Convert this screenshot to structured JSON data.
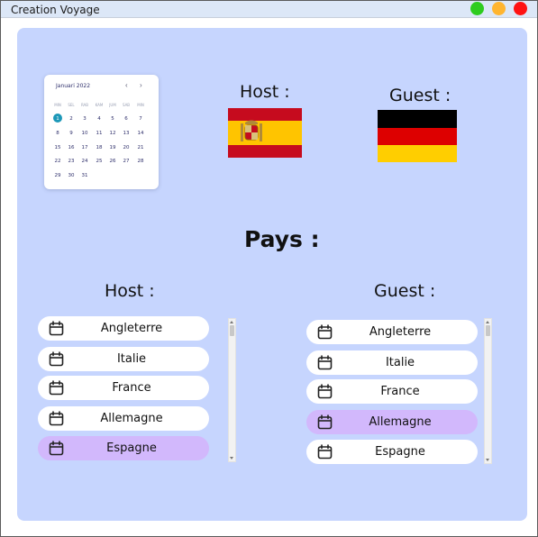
{
  "window": {
    "title": "Creation Voyage",
    "controls": {
      "green": "#2ecc1f",
      "yellow": "#ffb530",
      "red": "#ff1212"
    }
  },
  "calendar": {
    "month_label": "Januari 2022",
    "prev_icon": "chevron-left-icon",
    "next_icon": "chevron-right-icon",
    "weekdays": [
      "MIN",
      "SEL",
      "RAB",
      "KAM",
      "JUM",
      "SAB",
      "MIN"
    ],
    "weeks": [
      [
        "1",
        "2",
        "3",
        "4",
        "5",
        "6",
        "7"
      ],
      [
        "8",
        "9",
        "10",
        "11",
        "12",
        "13",
        "14"
      ],
      [
        "15",
        "16",
        "17",
        "18",
        "19",
        "20",
        "21"
      ],
      [
        "22",
        "23",
        "24",
        "25",
        "26",
        "27",
        "28"
      ],
      [
        "29",
        "30",
        "31"
      ]
    ],
    "selected_day": "1",
    "accent": "#1d98b8"
  },
  "top": {
    "host_label": "Host :",
    "guest_label": "Guest :",
    "host_flag": "spain-flag",
    "guest_flag": "germany-flag"
  },
  "pays_title": "Pays :",
  "host_list": {
    "label": "Host :",
    "items": [
      "Angleterre",
      "Italie",
      "France",
      "Allemagne",
      "Espagne"
    ],
    "selected": "Espagne"
  },
  "guest_list": {
    "label": "Guest :",
    "items": [
      "Angleterre",
      "Italie",
      "France",
      "Allemagne",
      "Espagne"
    ],
    "selected": "Allemagne"
  },
  "colors": {
    "panel": "#c6d5fe",
    "selected_item": "#d2b8fc",
    "item": "#ffffff"
  },
  "item_icon": "calendar-icon"
}
